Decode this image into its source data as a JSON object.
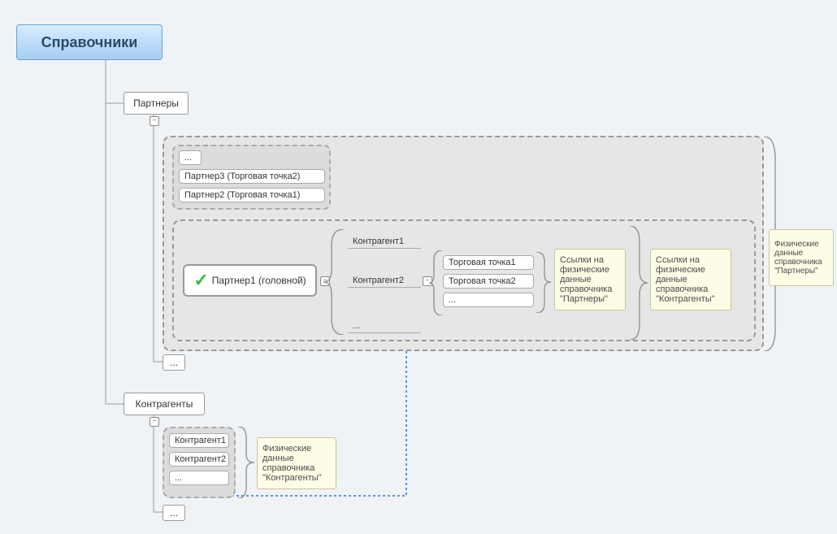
{
  "title": "Справочники",
  "tree": {
    "partners_label": "Партнеры",
    "counterparties_label": "Контрагенты"
  },
  "partners_group": {
    "more": "...",
    "items": [
      "Партнер3 (Торговая точка2)",
      "Партнер2 (Торговая точка1)"
    ]
  },
  "main_partner": "Партнер1 (головной)",
  "contragents_inside": {
    "c1": "Контрагент1",
    "c2": "Контрагент2",
    "more": "..."
  },
  "shops": {
    "t1": "Торговая точка1",
    "t2": "Торговая точка2",
    "more": "..."
  },
  "notes": {
    "partners_links": "Ссылки на физические данные справочника \"Партнеры\"",
    "counterparties_links": "Ссылки на физические данные справочника \"Контрагенты\"",
    "partners_phys": "Физические данные справочника \"Партнеры\"",
    "counterparties_phys": "Физические данные справочника \"Контрагенты\""
  },
  "counterparties_group": {
    "c1": "Контрагент1",
    "c2": "Контрагент2",
    "more": "..."
  },
  "tree_more": "...",
  "minus": "−"
}
